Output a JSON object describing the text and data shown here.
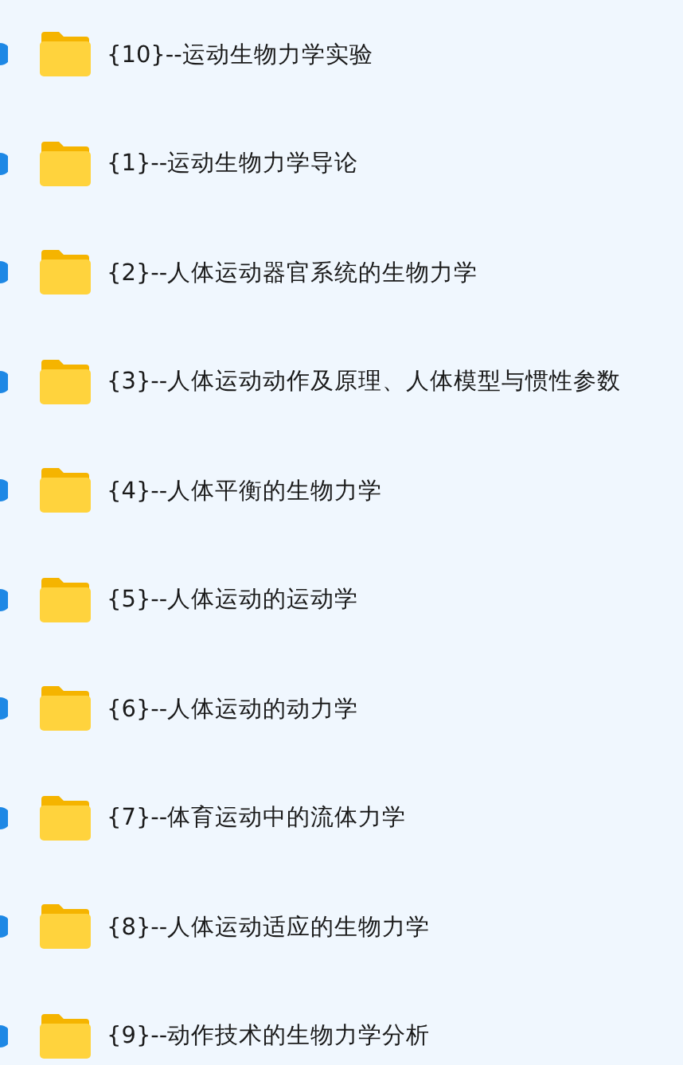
{
  "folders": [
    {
      "name": "{10}--运动生物力学实验"
    },
    {
      "name": "{1}--运动生物力学导论"
    },
    {
      "name": "{2}--人体运动器官系统的生物力学"
    },
    {
      "name": "{3}--人体运动动作及原理、人体模型与惯性参数"
    },
    {
      "name": "{4}--人体平衡的生物力学"
    },
    {
      "name": "{5}--人体运动的运动学"
    },
    {
      "name": "{6}--人体运动的动力学"
    },
    {
      "name": "{7}--体育运动中的流体力学"
    },
    {
      "name": "{8}--人体运动适应的生物力学"
    },
    {
      "name": "{9}--动作技术的生物力学分析"
    }
  ]
}
